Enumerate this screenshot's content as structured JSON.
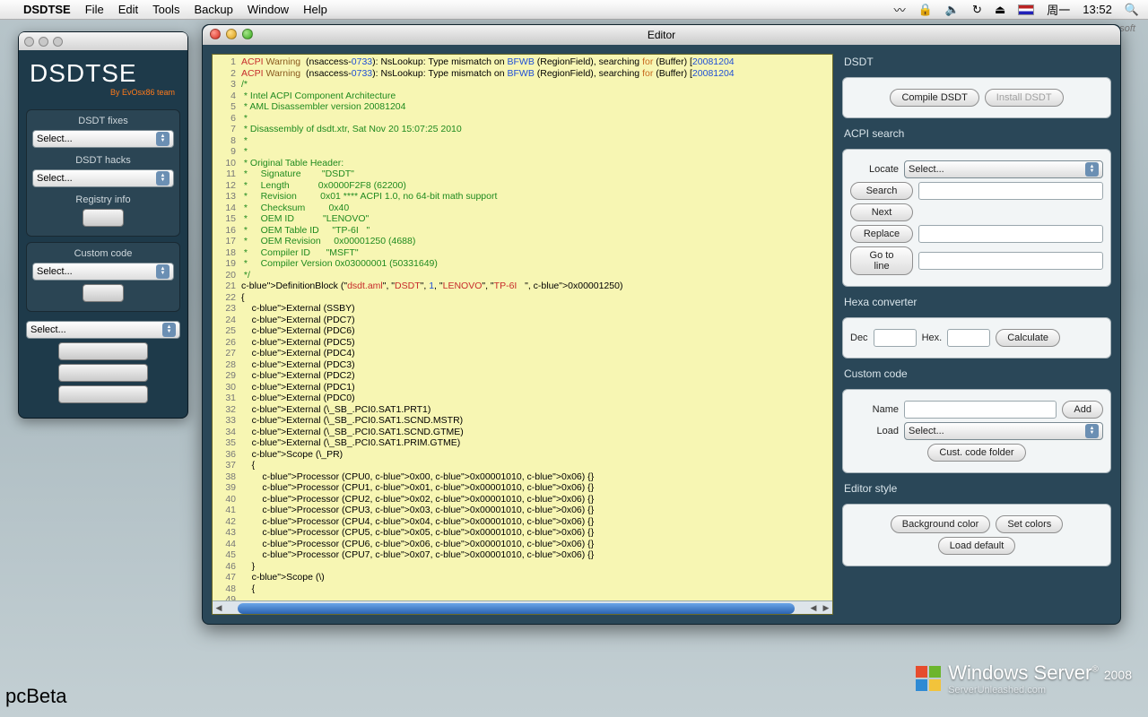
{
  "menubar": {
    "items": [
      "DSDTSE",
      "File",
      "Edit",
      "Tools",
      "Backup",
      "Window",
      "Help"
    ],
    "day": "周一",
    "time": "13:52"
  },
  "toolwin": {
    "logo1": "DSDT",
    "logo2": "SE",
    "subtitle": "By EvOsx86 team",
    "fixes_label": "DSDT fixes",
    "fixes_sel": "Select...",
    "hacks_label": "DSDT hacks",
    "hacks_sel": "Select...",
    "registry_label": "Registry info",
    "custom_label": "Custom code",
    "custom_sel": "Select...",
    "bottom_sel": "Select..."
  },
  "editor": {
    "title": "Editor",
    "code_lines": [
      "ACPI Warning (nsaccess-0733): NsLookup: Type mismatch on BFWB (RegionField), searching for (Buffer) [20081204",
      "ACPI Warning (nsaccess-0733): NsLookup: Type mismatch on BFWB (RegionField), searching for (Buffer) [20081204",
      "/*",
      " * Intel ACPI Component Architecture",
      " * AML Disassembler version 20081204",
      " *",
      " * Disassembly of dsdt.xtr, Sat Nov 20 15:07:25 2010",
      " *",
      " *",
      " * Original Table Header:",
      " *     Signature        \"DSDT\"",
      " *     Length           0x0000F2F8 (62200)",
      " *     Revision         0x01 **** ACPI 1.0, no 64-bit math support",
      " *     Checksum         0x40",
      " *     OEM ID           \"LENOVO\"",
      " *     OEM Table ID     \"TP-6I   \"",
      " *     OEM Revision     0x00001250 (4688)",
      " *     Compiler ID      \"MSFT\"",
      " *     Compiler Version 0x03000001 (50331649)",
      " */",
      "DefinitionBlock (\"dsdt.aml\", \"DSDT\", 1, \"LENOVO\", \"TP-6I   \", 0x00001250)",
      "{",
      "    External (SSBY)",
      "    External (PDC7)",
      "    External (PDC6)",
      "    External (PDC5)",
      "    External (PDC4)",
      "    External (PDC3)",
      "    External (PDC2)",
      "    External (PDC1)",
      "    External (PDC0)",
      "    External (\\_SB_.PCI0.SAT1.PRT1)",
      "    External (\\_SB_.PCI0.SAT1.SCND.MSTR)",
      "    External (\\_SB_.PCI0.SAT1.SCND.GTME)",
      "    External (\\_SB_.PCI0.SAT1.PRIM.GTME)",
      "",
      "    Scope (\\_PR)",
      "    {",
      "        Processor (CPU0, 0x00, 0x00001010, 0x06) {}",
      "        Processor (CPU1, 0x01, 0x00001010, 0x06) {}",
      "        Processor (CPU2, 0x02, 0x00001010, 0x06) {}",
      "        Processor (CPU3, 0x03, 0x00001010, 0x06) {}",
      "        Processor (CPU4, 0x04, 0x00001010, 0x06) {}",
      "        Processor (CPU5, 0x05, 0x00001010, 0x06) {}",
      "        Processor (CPU6, 0x06, 0x00001010, 0x06) {}",
      "        Processor (CPU7, 0x07, 0x00001010, 0x06) {}",
      "    }",
      "",
      "    Scope (\\)",
      "    {"
    ]
  },
  "right": {
    "dsdt_title": "DSDT",
    "compile": "Compile DSDT",
    "install": "Install DSDT",
    "acpi_title": "ACPI search",
    "locate": "Locate",
    "locate_sel": "Select...",
    "search": "Search",
    "next": "Next",
    "replace": "Replace",
    "gotoline": "Go to line",
    "hex_title": "Hexa converter",
    "dec": "Dec",
    "hex": "Hex.",
    "calc": "Calculate",
    "cc_title": "Custom code",
    "name": "Name",
    "add": "Add",
    "load": "Load",
    "load_sel": "Select...",
    "folder": "Cust. code folder",
    "es_title": "Editor style",
    "bgcolor": "Background color",
    "setcolors": "Set colors",
    "loaddef": "Load default"
  },
  "footer": {
    "pcbeta": "pcBeta",
    "winserv": "Windows Server",
    "year": "2008",
    "tag": "ServerUnleashed.com",
    "ms": "Microsoft"
  }
}
